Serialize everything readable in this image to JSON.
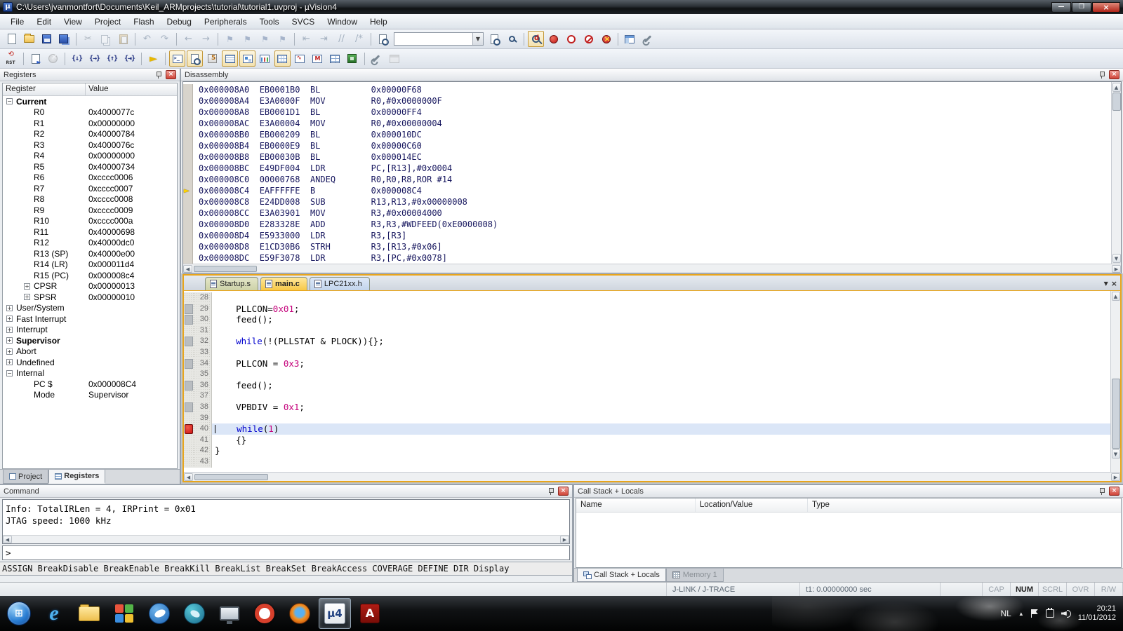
{
  "window": {
    "title": "C:\\Users\\jvanmontfort\\Documents\\Keil_ARMprojects\\tutorial\\tutorial1.uvproj - µVision4"
  },
  "menu": [
    "File",
    "Edit",
    "View",
    "Project",
    "Flash",
    "Debug",
    "Peripherals",
    "Tools",
    "SVCS",
    "Window",
    "Help"
  ],
  "colors": {
    "active_frame_orange": "#e8a51c",
    "breakpoint_red": "#cc1414",
    "current_line_blue": "#dbe6f7",
    "keyword_blue": "#0000cd",
    "number_magenta": "#c4007a",
    "close_button_red": "#cf4438"
  },
  "toolbars": {
    "search_value": "",
    "standard": [
      {
        "name": "new-file-button",
        "shape": "sh-doc"
      },
      {
        "name": "open-file-button",
        "shape": "sh-folder"
      },
      {
        "name": "save-button",
        "shape": "sh-floppy"
      },
      {
        "name": "save-all-button",
        "shape": "sh-floppy2"
      },
      {
        "name": "cut-button",
        "shape": "sh-cut",
        "sep": true,
        "disabled": true
      },
      {
        "name": "copy-button",
        "shape": "sh-copy",
        "disabled": true
      },
      {
        "name": "paste-button",
        "shape": "sh-paste",
        "disabled": true
      },
      {
        "name": "undo-button",
        "glyph": "↶",
        "sep": true,
        "disabled": true
      },
      {
        "name": "redo-button",
        "glyph": "↷",
        "disabled": true
      },
      {
        "name": "navigate-back-button",
        "glyph": "←",
        "sep": true,
        "disabled": true
      },
      {
        "name": "navigate-forward-button",
        "glyph": "→",
        "disabled": true
      },
      {
        "name": "bookmark-toggle-button",
        "shape": "sh-flag",
        "sep": true,
        "disabled": true
      },
      {
        "name": "bookmark-prev-button",
        "shape": "sh-flag",
        "disabled": true
      },
      {
        "name": "bookmark-next-button",
        "shape": "sh-flag",
        "disabled": true
      },
      {
        "name": "bookmark-clear-button",
        "shape": "sh-flag",
        "disabled": true
      },
      {
        "name": "unindent-button",
        "glyph": "⇤",
        "sep": true,
        "disabled": true
      },
      {
        "name": "indent-button",
        "glyph": "⇥",
        "disabled": true
      },
      {
        "name": "comment-button",
        "glyph": "//",
        "disabled": true
      },
      {
        "name": "uncomment-button",
        "glyph": "/*",
        "disabled": true
      },
      {
        "name": "find-in-files-button",
        "shape": "sh-docmag",
        "sep": true
      },
      {
        "type": "search",
        "name": "search-combobox"
      },
      {
        "name": "lookup-button",
        "shape": "sh-docmag"
      },
      {
        "name": "find-button",
        "shape": "sh-mag"
      },
      {
        "name": "start-stop-debug-button",
        "shape": "sh-magd",
        "pressed": true,
        "sep": true
      },
      {
        "name": "insert-breakpoint-button",
        "shape": "sh-bp-full"
      },
      {
        "name": "disable-breakpoint-button",
        "shape": "sh-bp-hollow"
      },
      {
        "name": "disable-all-breakpoints-button",
        "shape": "sh-bp-slash"
      },
      {
        "name": "kill-all-breakpoints-button",
        "shape": "sh-bp-x"
      },
      {
        "name": "views-layout-button",
        "shape": "sh-layout",
        "dd": true,
        "sep": true
      },
      {
        "name": "configure-uvision-button",
        "shape": "sh-wrench"
      }
    ],
    "debug": [
      {
        "name": "reset-button",
        "shape": "sh-rst"
      },
      {
        "name": "run-button",
        "shape": "sh-run",
        "sep": true
      },
      {
        "name": "stop-button",
        "shape": "sh-stop",
        "disabled": true
      },
      {
        "name": "step-button",
        "glyph": "{↓}",
        "gcls": "gstep",
        "sep": true
      },
      {
        "name": "step-over-button",
        "glyph": "{→}",
        "gcls": "gstep"
      },
      {
        "name": "step-out-button",
        "glyph": "{↑}",
        "gcls": "gstep"
      },
      {
        "name": "run-to-line-button",
        "glyph": "{⇥}",
        "gcls": "gstep"
      },
      {
        "name": "show-next-statement-button",
        "glyph": "►",
        "gcls": "g-yellow",
        "sep": true
      },
      {
        "name": "command-window-button",
        "shape": "sh-term",
        "pressed": true,
        "sep": true
      },
      {
        "name": "disassembly-window-button",
        "shape": "sh-docmag",
        "pressed": true
      },
      {
        "name": "symbol-window-button",
        "shape": "sh-serial"
      },
      {
        "name": "registers-window-button",
        "shape": "sh-lines",
        "pressed": true
      },
      {
        "name": "callstack-window-button",
        "shape": "sh-watch",
        "pressed": true
      },
      {
        "name": "watch-window-button",
        "shape": "sh-chart",
        "dd": true
      },
      {
        "name": "memory-window-button",
        "shape": "sh-grid",
        "dd": true,
        "pressed": true
      },
      {
        "name": "serial-window-button",
        "shape": "sh-sig",
        "dd": true
      },
      {
        "name": "analysis-window-button",
        "shape": "sh-chartm",
        "dd": true
      },
      {
        "name": "trace-window-button",
        "shape": "sh-grid2",
        "dd": true
      },
      {
        "name": "system-viewer-button",
        "shape": "sh-chip",
        "dd": true
      },
      {
        "name": "toolbox-button",
        "shape": "sh-wrench",
        "dd": true,
        "sep": true
      },
      {
        "name": "restore-views-button",
        "shape": "sh-layout2",
        "disabled": true
      }
    ]
  },
  "registers_panel": {
    "title": "Registers",
    "columns": [
      "Register",
      "Value"
    ],
    "rows": [
      {
        "label": "Current",
        "value": "",
        "level": 0,
        "expand": "minus",
        "bold": true
      },
      {
        "label": "R0",
        "value": "0x4000077c",
        "level": 1
      },
      {
        "label": "R1",
        "value": "0x00000000",
        "level": 1
      },
      {
        "label": "R2",
        "value": "0x40000784",
        "level": 1
      },
      {
        "label": "R3",
        "value": "0x4000076c",
        "level": 1
      },
      {
        "label": "R4",
        "value": "0x00000000",
        "level": 1
      },
      {
        "label": "R5",
        "value": "0x40000734",
        "level": 1
      },
      {
        "label": "R6",
        "value": "0xcccc0006",
        "level": 1
      },
      {
        "label": "R7",
        "value": "0xcccc0007",
        "level": 1
      },
      {
        "label": "R8",
        "value": "0xcccc0008",
        "level": 1
      },
      {
        "label": "R9",
        "value": "0xcccc0009",
        "level": 1
      },
      {
        "label": "R10",
        "value": "0xcccc000a",
        "level": 1
      },
      {
        "label": "R11",
        "value": "0x40000698",
        "level": 1
      },
      {
        "label": "R12",
        "value": "0x40000dc0",
        "level": 1
      },
      {
        "label": "R13 (SP)",
        "value": "0x40000e00",
        "level": 1
      },
      {
        "label": "R14 (LR)",
        "value": "0x000011d4",
        "level": 1
      },
      {
        "label": "R15 (PC)",
        "value": "0x000008c4",
        "level": 1
      },
      {
        "label": "CPSR",
        "value": "0x00000013",
        "level": 1,
        "expand": "plus"
      },
      {
        "label": "SPSR",
        "value": "0x00000010",
        "level": 1,
        "expand": "plus"
      },
      {
        "label": "User/System",
        "value": "",
        "level": 0,
        "expand": "plus"
      },
      {
        "label": "Fast Interrupt",
        "value": "",
        "level": 0,
        "expand": "plus"
      },
      {
        "label": "Interrupt",
        "value": "",
        "level": 0,
        "expand": "plus"
      },
      {
        "label": "Supervisor",
        "value": "",
        "level": 0,
        "expand": "plus",
        "bold": true
      },
      {
        "label": "Abort",
        "value": "",
        "level": 0,
        "expand": "plus"
      },
      {
        "label": "Undefined",
        "value": "",
        "level": 0,
        "expand": "plus"
      },
      {
        "label": "Internal",
        "value": "",
        "level": 0,
        "expand": "minus"
      },
      {
        "label": "PC $",
        "value": "0x000008C4",
        "level": 1
      },
      {
        "label": "Mode",
        "value": "Supervisor",
        "level": 1
      }
    ],
    "tabs": [
      {
        "label": "Project",
        "active": false
      },
      {
        "label": "Registers",
        "active": true
      }
    ]
  },
  "disassembly": {
    "title": "Disassembly",
    "lines": [
      {
        "addr": "0x000008A0",
        "op": "EB0001B0",
        "mn": "BL",
        "args": "0x00000F68"
      },
      {
        "addr": "0x000008A4",
        "op": "E3A0000F",
        "mn": "MOV",
        "args": "R0,#0x0000000F"
      },
      {
        "addr": "0x000008A8",
        "op": "EB0001D1",
        "mn": "BL",
        "args": "0x00000FF4"
      },
      {
        "addr": "0x000008AC",
        "op": "E3A00004",
        "mn": "MOV",
        "args": "R0,#0x00000004"
      },
      {
        "addr": "0x000008B0",
        "op": "EB000209",
        "mn": "BL",
        "args": "0x000010DC"
      },
      {
        "addr": "0x000008B4",
        "op": "EB0000E9",
        "mn": "BL",
        "args": "0x00000C60"
      },
      {
        "addr": "0x000008B8",
        "op": "EB00030B",
        "mn": "BL",
        "args": "0x000014EC"
      },
      {
        "addr": "0x000008BC",
        "op": "E49DF004",
        "mn": "LDR",
        "args": "PC,[R13],#0x0004"
      },
      {
        "addr": "0x000008C0",
        "op": "00000768",
        "mn": "ANDEQ",
        "args": "R0,R0,R8,ROR #14"
      },
      {
        "addr": "0x000008C4",
        "op": "EAFFFFFE",
        "mn": "B",
        "args": "0x000008C4",
        "current": true
      },
      {
        "addr": "0x000008C8",
        "op": "E24DD008",
        "mn": "SUB",
        "args": "R13,R13,#0x00000008"
      },
      {
        "addr": "0x000008CC",
        "op": "E3A03901",
        "mn": "MOV",
        "args": "R3,#0x00004000"
      },
      {
        "addr": "0x000008D0",
        "op": "E283328E",
        "mn": "ADD",
        "args": "R3,R3,#WDFEED(0xE0000008)"
      },
      {
        "addr": "0x000008D4",
        "op": "E5933000",
        "mn": "LDR",
        "args": "R3,[R3]"
      },
      {
        "addr": "0x000008D8",
        "op": "E1CD30B6",
        "mn": "STRH",
        "args": "R3,[R13,#0x06]"
      },
      {
        "addr": "0x000008DC",
        "op": "E59F3078",
        "mn": "LDR",
        "args": "R3,[PC,#0x0078]"
      }
    ]
  },
  "editor": {
    "tabs": [
      {
        "label": "Startup.s",
        "active": false
      },
      {
        "label": "main.c",
        "active": true
      },
      {
        "label": "LPC21xx.h",
        "active": false
      }
    ],
    "lines": [
      {
        "n": 28,
        "segs": []
      },
      {
        "n": 29,
        "mark": "gray",
        "segs": [
          [
            "p",
            "    PLLCON="
          ],
          [
            "num",
            "0x01"
          ],
          [
            "p",
            ";"
          ]
        ]
      },
      {
        "n": 30,
        "mark": "gray",
        "segs": [
          [
            "p",
            "    feed();"
          ]
        ]
      },
      {
        "n": 31,
        "segs": []
      },
      {
        "n": 32,
        "mark": "gray",
        "segs": [
          [
            "p",
            "    "
          ],
          [
            "kw",
            "while"
          ],
          [
            "p",
            "(!(PLLSTAT & PLOCK)){};"
          ]
        ]
      },
      {
        "n": 33,
        "segs": []
      },
      {
        "n": 34,
        "mark": "gray",
        "segs": [
          [
            "p",
            "    PLLCON = "
          ],
          [
            "num",
            "0x3"
          ],
          [
            "p",
            ";"
          ]
        ]
      },
      {
        "n": 35,
        "segs": []
      },
      {
        "n": 36,
        "mark": "gray",
        "segs": [
          [
            "p",
            "    feed();"
          ]
        ]
      },
      {
        "n": 37,
        "segs": []
      },
      {
        "n": 38,
        "mark": "gray",
        "segs": [
          [
            "p",
            "    VPBDIV = "
          ],
          [
            "num",
            "0x1"
          ],
          [
            "p",
            ";"
          ]
        ]
      },
      {
        "n": 39,
        "segs": []
      },
      {
        "n": 40,
        "mark": "bp",
        "current": true,
        "segs": [
          [
            "p",
            "    "
          ],
          [
            "kw",
            "while"
          ],
          [
            "p",
            "("
          ],
          [
            "num",
            "1"
          ],
          [
            "p",
            ")"
          ]
        ]
      },
      {
        "n": 41,
        "segs": [
          [
            "p",
            "    {}"
          ]
        ]
      },
      {
        "n": 42,
        "segs": [
          [
            "p",
            "}"
          ]
        ]
      },
      {
        "n": 43,
        "segs": []
      }
    ]
  },
  "command_panel": {
    "title": "Command",
    "output": [
      "Info: TotalIRLen = 4, IRPrint = 0x01",
      "JTAG speed: 1000 kHz"
    ],
    "prompt": ">",
    "commands": "ASSIGN BreakDisable BreakEnable BreakKill BreakList BreakSet BreakAccess COVERAGE DEFINE DIR Display"
  },
  "callstack_panel": {
    "title": "Call Stack + Locals",
    "columns": [
      "Name",
      "Location/Value",
      "Type"
    ],
    "tabs": [
      {
        "label": "Call Stack + Locals",
        "active": true
      },
      {
        "label": "Memory 1",
        "active": false
      }
    ]
  },
  "status_bar": {
    "device": "J-LINK / J-TRACE",
    "time": "t1: 0.00000000 sec",
    "flags": [
      "CAP",
      "NUM",
      "SCRL",
      "OVR",
      "R/W"
    ],
    "active_flag": "NUM"
  },
  "taskbar": {
    "icons": [
      {
        "name": "start-button",
        "cls": "tk-start"
      },
      {
        "name": "internet-explorer-icon",
        "cls": "tk-ie",
        "glyph": "e"
      },
      {
        "name": "windows-explorer-icon",
        "cls": "tk-folder"
      },
      {
        "name": "media-app-icon",
        "cls": "tk-grid",
        "grid": true
      },
      {
        "name": "thunderbird-icon",
        "cls": "tk-bird"
      },
      {
        "name": "messenger-app-icon",
        "cls": "tk-bird2"
      },
      {
        "name": "presentation-app-icon",
        "cls": "tk-screen"
      },
      {
        "name": "opera-icon",
        "cls": "tk-opera"
      },
      {
        "name": "firefox-icon",
        "cls": "tk-firefox"
      },
      {
        "name": "uvision-taskbar-icon",
        "cls": "tk-uvision",
        "glyph": "µ4",
        "active": true
      },
      {
        "name": "adobe-reader-icon",
        "cls": "tk-adobe",
        "glyph": "A"
      }
    ],
    "language": "NL",
    "clock_time": "20:21",
    "clock_date": "11/01/2012"
  }
}
